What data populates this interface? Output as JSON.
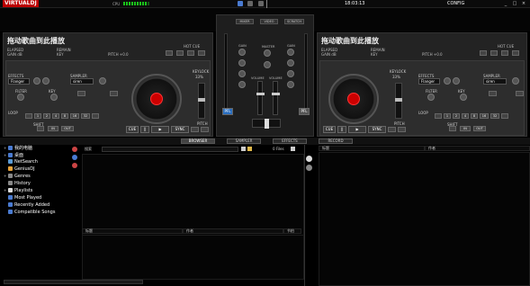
{
  "app": {
    "logo": "VIRTUALDJ",
    "cpu_label": "CPU",
    "clock": "18:03:13",
    "config_label": "CONFIG"
  },
  "deck_left": {
    "title": "拖动歌曲到此播放",
    "elapsed": "ELAPSED",
    "remain": "REMAIN",
    "gain": "GAIN dB",
    "key": "KEY",
    "pitch": "PITCH +0.0",
    "hot_cue": "HOT CUE",
    "effects": "EFFECTS",
    "effect_value": "Flanger",
    "sampler": "SAMPLER",
    "sampler_value": "siren",
    "filter": "FILTER",
    "key2": "KEY",
    "loop": "LOOP",
    "shift": "SHIFT",
    "in": "IN",
    "out": "OUT",
    "cue": "CUE",
    "play": "▶",
    "sync": "SYNC",
    "keylock": "KEYLOCK",
    "percent": "33%",
    "pitch_lbl": "PITCH",
    "loop_values": [
      "1",
      "2",
      "4",
      "8",
      "16",
      "32"
    ]
  },
  "deck_right": {
    "title": "拖动歌曲到此播放",
    "elapsed": "ELAPSED",
    "remain": "REMAIN",
    "gain": "GAIN dB",
    "key": "KEY",
    "pitch": "PITCH +0.0",
    "hot_cue": "HOT CUE",
    "effects": "EFFECTS",
    "effect_value": "Flanger",
    "sampler": "SAMPLER",
    "sampler_value": "siren",
    "filter": "FILTER",
    "key2": "KEY",
    "loop": "LOOP",
    "shift": "SHIFT",
    "in": "IN",
    "out": "OUT",
    "cue": "CUE",
    "play": "▶",
    "sync": "SYNC",
    "keylock": "KEYLOCK",
    "percent": "33%",
    "pitch_lbl": "PITCH",
    "loop_values": [
      "1",
      "2",
      "4",
      "8",
      "16",
      "32"
    ]
  },
  "mixer": {
    "tabs": [
      "MIXER",
      "VIDEO",
      "SCRATCH"
    ],
    "master": "MASTER",
    "gain": "GAIN",
    "high": "HIGH",
    "mid": "MID",
    "low": "LOW",
    "volume": "VOLUME",
    "pfl_left": "PFL",
    "pfl_right": "PFL"
  },
  "tabs": [
    "BROWSER",
    "SAMPLER",
    "EFFECTS",
    "RECORD"
  ],
  "browser": {
    "tree": [
      "我的电脑",
      "桌面",
      "NetSearch",
      "GeniusDJ",
      "Genres",
      "History",
      "Playlists",
      "Most Played",
      "Recently Added",
      "Compatible Songs"
    ],
    "search_label": "搜索",
    "files_count": "0 Files",
    "columns_main": [
      "标题",
      "作者",
      "节拍"
    ],
    "columns_right": [
      "标题",
      "作者"
    ]
  },
  "colors": {
    "accent": "#c00000",
    "tree_icon": "#4a7bd1"
  }
}
